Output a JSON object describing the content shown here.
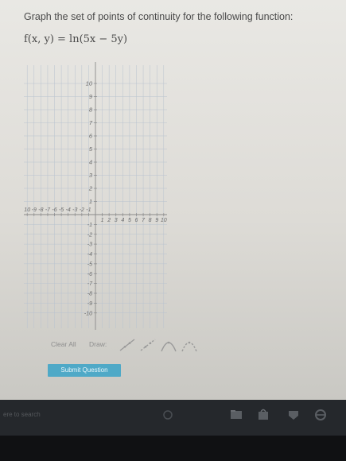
{
  "question": {
    "prompt": "Graph the set of points of continuity for the following function:",
    "formula": "f(x, y) = ln(5x − 5y)"
  },
  "graph": {
    "x_range": [
      -10,
      10
    ],
    "y_range": [
      -10,
      10
    ],
    "x_tick_labels": [
      "10",
      "-9",
      "-8",
      "-7",
      "-6",
      "-5",
      "-4",
      "-3",
      "-2",
      "-1",
      "1",
      "2",
      "3",
      "4",
      "5",
      "6",
      "7",
      "8",
      "9",
      "10"
    ],
    "y_tick_labels_positive": [
      "10",
      "9",
      "8",
      "7",
      "6",
      "5",
      "4",
      "3",
      "2",
      "1"
    ],
    "y_tick_labels_negative": [
      "-1",
      "-2",
      "-3",
      "-4",
      "-5",
      "-6",
      "-7",
      "-8",
      "-9",
      "-10"
    ],
    "grid": true,
    "grid_color": "#b9c3cf",
    "axis_color": "#8a8a8a"
  },
  "toolbar": {
    "clear_all_label": "Clear All",
    "draw_label": "Draw:",
    "tools": [
      "line-tool-icon",
      "dashed-line-tool-icon",
      "parabola-tool-icon",
      "dashed-parabola-tool-icon"
    ]
  },
  "submit": {
    "label": "Submit Question"
  },
  "taskbar": {
    "search_text": "ere to search",
    "icons": [
      "task-view-icon",
      "file-explorer-icon",
      "store-icon",
      "mail-icon",
      "edge-icon"
    ]
  }
}
